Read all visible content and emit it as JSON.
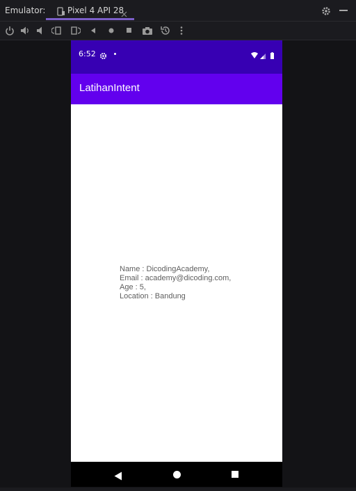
{
  "ide": {
    "panel_title": "Emulator:",
    "tab_label": "Pixel 4 API 28"
  },
  "toolbar": {
    "icons": [
      "power-icon",
      "volume-up-icon",
      "volume-down-icon",
      "rotate-left-icon",
      "rotate-right-icon",
      "back-icon",
      "home-icon",
      "overview-icon",
      "camera-icon",
      "snapshot-icon",
      "more-icon"
    ]
  },
  "phone": {
    "status_bar": {
      "time": "6:52"
    },
    "app_bar": {
      "title": "LatihanIntent"
    },
    "content": {
      "lines": [
        "Name : DicodingAcademy,",
        "Email : academy@dicoding.com,",
        "Age : 5,",
        "Location : Bandung"
      ]
    }
  },
  "colors": {
    "status_bar": "#3700b3",
    "app_bar": "#6200ee",
    "tab_underline": "#7b5fc8"
  }
}
